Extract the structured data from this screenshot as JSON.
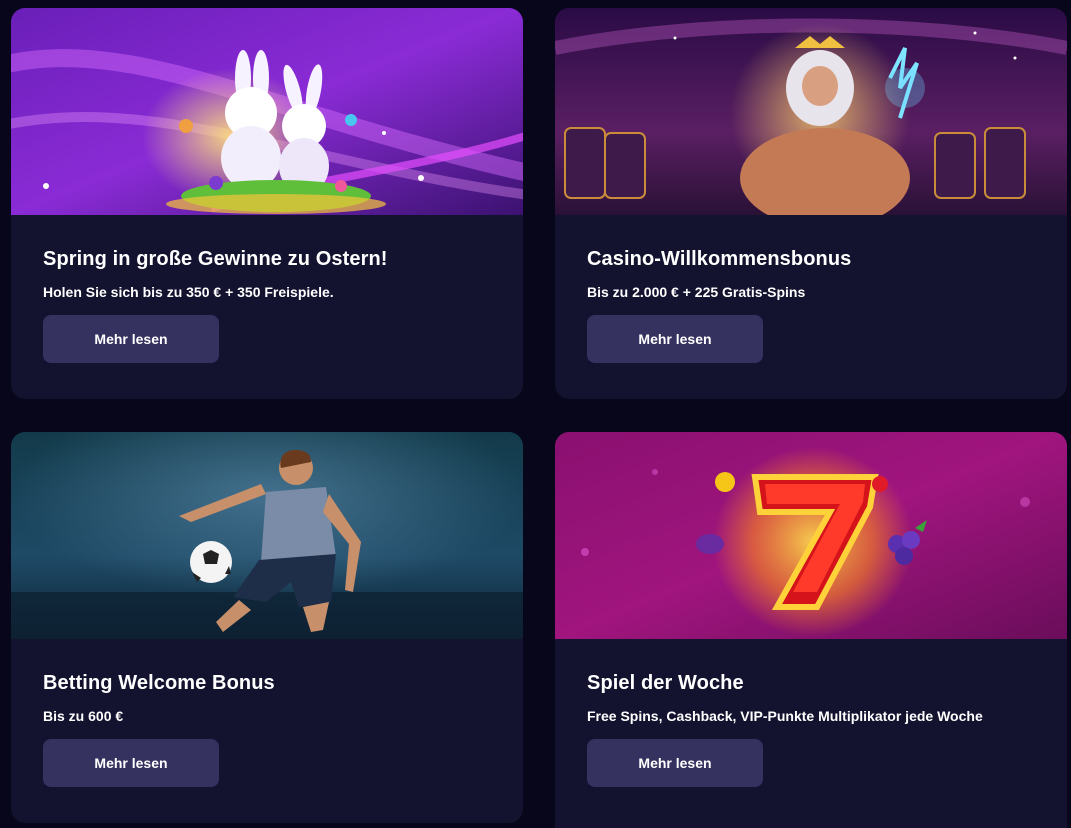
{
  "promotions": [
    {
      "title": "Spring in große Gewinne zu Ostern!",
      "subtitle": "Holen Sie sich bis zu 350 € + 350 Freispiele.",
      "button_label": "Mehr lesen",
      "image": "easter-bunnies-banner"
    },
    {
      "title": "Casino-Willkommensbonus",
      "subtitle": "Bis zu 2.000 € + 225 Gratis-Spins",
      "button_label": "Mehr lesen",
      "image": "zeus-casino-banner"
    },
    {
      "title": "Betting Welcome Bonus",
      "subtitle": "Bis zu 600 €",
      "button_label": "Mehr lesen",
      "image": "football-player-banner"
    },
    {
      "title": "Spiel der Woche",
      "subtitle": "Free Spins, Cashback, VIP-Punkte Multiplikator jede Woche",
      "button_label": "Mehr lesen",
      "image": "lucky-seven-slot-banner"
    }
  ],
  "colors": {
    "page_background": "#07061a",
    "card_background": "#13122f",
    "button_background": "#35325f",
    "text": "#ffffff"
  }
}
